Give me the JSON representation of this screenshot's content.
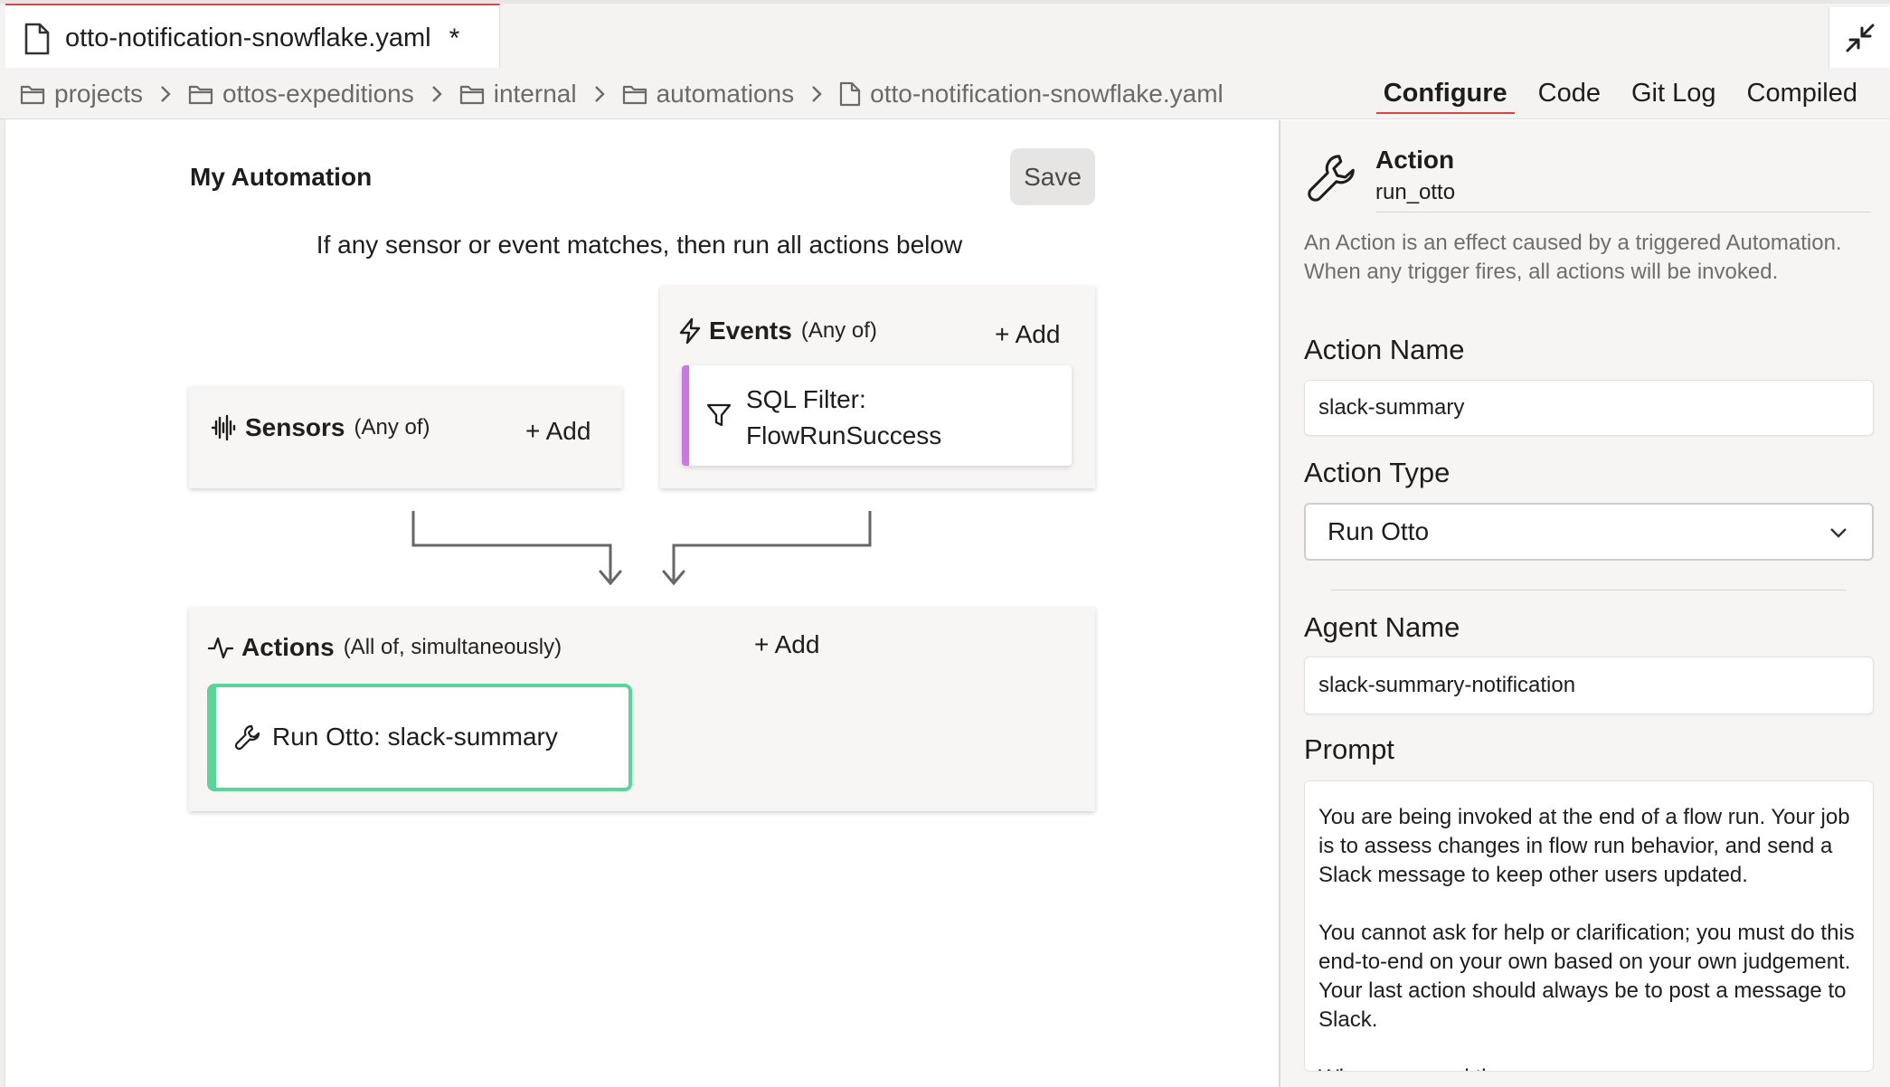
{
  "tab": {
    "title": "otto-notification-snowflake.yaml",
    "modified_marker": "*"
  },
  "breadcrumb": [
    "projects",
    "ottos-expeditions",
    "internal",
    "automations",
    "otto-notification-snowflake.yaml"
  ],
  "view_tabs": [
    "Configure",
    "Code",
    "Git Log",
    "Compiled"
  ],
  "active_view": "Configure",
  "automation": {
    "title": "My Automation",
    "save_label": "Save",
    "rule_text": "If any sensor or event matches, then run all actions below",
    "sensors": {
      "label": "Sensors",
      "qualifier": "(Any of)",
      "add_label": "+ Add"
    },
    "events": {
      "label": "Events",
      "qualifier": "(Any of)",
      "add_label": "+ Add",
      "items": [
        {
          "line1": "SQL Filter:",
          "line2": "FlowRunSuccess",
          "accent": "#c977e6"
        }
      ]
    },
    "actions": {
      "label": "Actions",
      "qualifier": "(All of, simultaneously)",
      "add_label": "+ Add",
      "items": [
        {
          "label": "Run Otto: slack-summary",
          "accent": "#5bd498"
        }
      ]
    }
  },
  "panel": {
    "kind": "Action",
    "id": "run_otto",
    "description": "An Action is an effect caused by a triggered Automation. When any trigger fires, all actions will be invoked.",
    "action_name_label": "Action Name",
    "action_name_value": "slack-summary",
    "action_type_label": "Action Type",
    "action_type_value": "Run Otto",
    "agent_name_label": "Agent Name",
    "agent_name_value": "slack-summary-notification",
    "prompt_label": "Prompt",
    "prompt_value": "You are being invoked at the end of a flow run. Your job is to assess changes in flow run behavior, and send a Slack message to keep other users updated.\n\nYou cannot ask for help or clarification; you must do this end-to-end on your own based on your own judgement. Your last action should always be to post a message to Slack.\n\nWhen you send the message"
  },
  "colors": {
    "active_tab_accent": "#d64545",
    "event_accent": "#c977e6",
    "action_accent": "#5bd498"
  }
}
